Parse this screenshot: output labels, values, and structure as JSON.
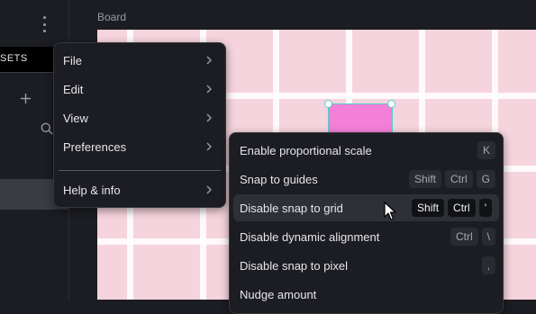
{
  "sidebar": {
    "tab_label": "SETS"
  },
  "board": {
    "label": "Board"
  },
  "main_menu": {
    "items": [
      {
        "label": "File"
      },
      {
        "label": "Edit"
      },
      {
        "label": "View"
      },
      {
        "label": "Preferences"
      },
      {
        "label": "Help & info"
      }
    ]
  },
  "preferences_menu": {
    "items": [
      {
        "label": "Enable proportional scale",
        "keys": [
          "K"
        ]
      },
      {
        "label": "Snap to guides",
        "keys": [
          "Shift",
          "Ctrl",
          "G"
        ]
      },
      {
        "label": "Disable snap to grid",
        "keys": [
          "Shift",
          "Ctrl",
          "'"
        ]
      },
      {
        "label": "Disable dynamic alignment",
        "keys": [
          "Ctrl",
          "\\"
        ]
      },
      {
        "label": "Disable snap to pixel",
        "keys": [
          ","
        ]
      },
      {
        "label": "Nudge amount",
        "keys": []
      }
    ],
    "hovered": "Disable snap to grid"
  },
  "colors": {
    "shape_fill": "#f47fd8",
    "selection": "#4fd1c5",
    "board_bg": "#f6d4dd",
    "menu_bg": "#1c1d22"
  },
  "icons": [
    "kebab-menu-icon",
    "plus-icon",
    "search-icon",
    "chevron-right-icon",
    "mouse-cursor-icon"
  ]
}
